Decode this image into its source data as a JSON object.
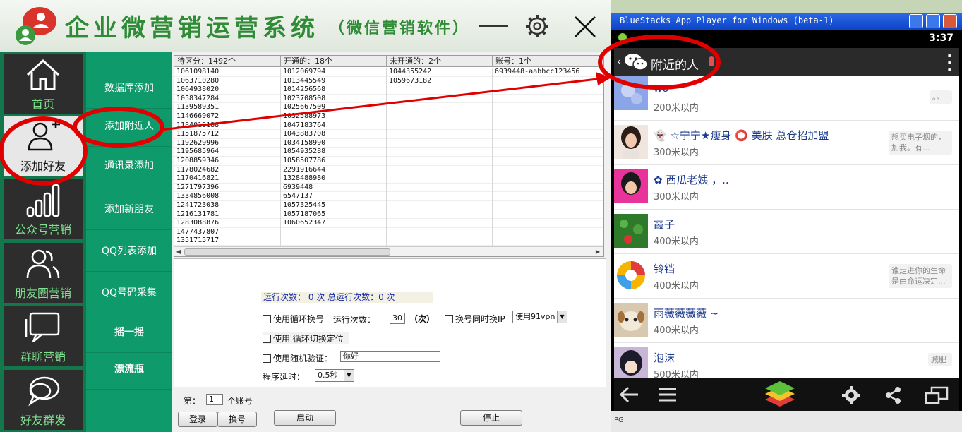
{
  "app": {
    "title": "企业微营销运营系统",
    "subtitle": "（微信营销软件）"
  },
  "leftnav": [
    {
      "label": "首页",
      "icon": "home-icon"
    },
    {
      "label": "添加好友",
      "icon": "add-user-icon"
    },
    {
      "label": "公众号营销",
      "icon": "bar-chart-icon"
    },
    {
      "label": "朋友圈营销",
      "icon": "people-icon"
    },
    {
      "label": "群聊营销",
      "icon": "chat-bubble-icon"
    },
    {
      "label": "好友群发",
      "icon": "broadcast-chat-icon"
    }
  ],
  "subnav": [
    {
      "label": "数据库添加"
    },
    {
      "label": "添加附近人"
    },
    {
      "label": "通讯录添加"
    },
    {
      "label": "添加新朋友"
    },
    {
      "label": "QQ列表添加"
    },
    {
      "label": "QQ号码采集"
    },
    {
      "label": "摇一摇"
    },
    {
      "label": "漂流瓶"
    }
  ],
  "grid": {
    "headers": [
      "待区分：1492个",
      "开通的：18个",
      "未开通的：2个",
      "账号：1个"
    ],
    "col0": [
      "1061098140",
      "1063710280",
      "1064938020",
      "1058347284",
      "1139589351",
      "1146669072",
      "1184019188",
      "1151875712",
      "1192629996",
      "1195685964",
      "1208859346",
      "1178024682",
      "1170416821",
      "1271797396",
      "1334856008",
      "1241723038",
      "1216131781",
      "1283088876",
      "1477437807",
      "1351715717"
    ],
    "col1": [
      "1012069794",
      "1013445549",
      "1014256568",
      "1023708508",
      "1025667509",
      "1032588973",
      "1047183764",
      "1043883708",
      "1034158990",
      "1054935288",
      "1058507786",
      "2291916644",
      "1328488980",
      "6939448",
      "6547137",
      "1057325445",
      "1057187065",
      "1060652347"
    ],
    "col2": [
      "1044355242",
      "1059673182"
    ],
    "col3": [
      "6939448-aabbcc123456"
    ]
  },
  "settings": {
    "run_count": "运行次数： 0 次    总运行次数：0 次",
    "loop_switch": "使用循环换号",
    "run_times_label": "运行次数：",
    "run_times_value": "30",
    "times_unit": "（次）",
    "switch_ip": "换号同时换IP",
    "vpn_select": "使用91vpn",
    "loop_location": "使用 循环切换定位",
    "random_verify": "使用随机验证：",
    "verify_text": "你好",
    "delay_label": "程序延时：",
    "delay_value": "0.5秒"
  },
  "bottom": {
    "account_prefix": "第：",
    "account_index": "1",
    "account_suffix": "个账号",
    "login": "登录",
    "switch": "换号",
    "start": "启动",
    "stop": "停止"
  },
  "bluestacks": {
    "window_title": "BlueStacks App Player for Windows (beta-1)",
    "clock": "3:37",
    "header_title": "附近的人",
    "bottom_text": "PG"
  },
  "nearby": [
    {
      "name": "wo",
      "dist": "200米以内",
      "sig": "。。"
    },
    {
      "name": "☆宁宁★瘦身 ⭕ 美肤 总仓招加盟",
      "dist": "300米以内",
      "sig": "想买电子烟的，加我。有..."
    },
    {
      "name": "✿ 西瓜老姨 ，..",
      "dist": "300米以内",
      "sig": ""
    },
    {
      "name": "霞子",
      "dist": "400米以内",
      "sig": ""
    },
    {
      "name": "铃铛",
      "dist": "400米以内",
      "sig": "谁走进你的生命是由命运决定..."
    },
    {
      "name": "雨薇薇薇薇 ~",
      "dist": "400米以内",
      "sig": ""
    },
    {
      "name": "泡沫",
      "dist": "500米以内",
      "sig": "减肥"
    }
  ],
  "colors": {
    "accent": "#2f8b36",
    "nav_dark": "#2d2d2d",
    "nav_green": "#13764c",
    "subnav_green": "#0e9a6a",
    "annotation": "#e00000"
  }
}
